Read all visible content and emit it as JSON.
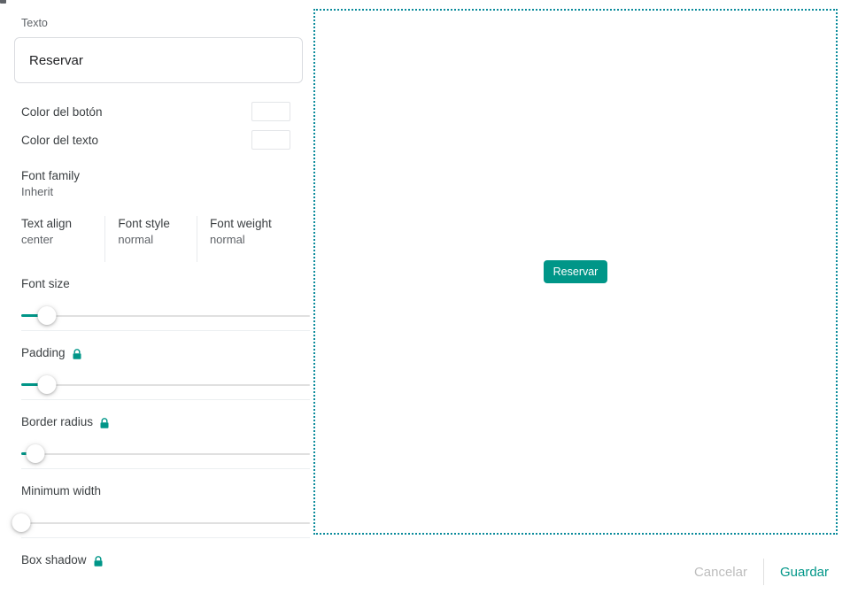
{
  "colors": {
    "accent": "#009688",
    "preview_border": "#0b8b9b",
    "button_color": "#009688",
    "text_color": "#ffffff",
    "muted": "#5f6368",
    "cancel": "#bdbdbd"
  },
  "settings": {
    "text_field": {
      "label": "Texto",
      "value": "Reservar",
      "placeholder": "Texto"
    },
    "button_color": {
      "label": "Color del botón",
      "swatch": "#009688"
    },
    "text_color": {
      "label": "Color del texto",
      "swatch": "#ffffff"
    },
    "font_family": {
      "label": "Font family",
      "value": "Inherit"
    },
    "typography": [
      {
        "label": "Text align",
        "value": "center"
      },
      {
        "label": "Font style",
        "value": "normal"
      },
      {
        "label": "Font weight",
        "value": "normal"
      }
    ],
    "sliders": [
      {
        "label": "Font size",
        "locked": false,
        "percent": 9
      },
      {
        "label": "Padding",
        "locked": true,
        "percent": 9
      },
      {
        "label": "Border radius",
        "locked": true,
        "percent": 5
      },
      {
        "label": "Minimum width",
        "locked": false,
        "percent": 0
      }
    ],
    "box_shadow": {
      "label": "Box shadow",
      "locked": true
    }
  },
  "preview": {
    "button_label": "Reservar"
  },
  "footer": {
    "cancel_label": "Cancelar",
    "save_label": "Guardar"
  },
  "icons": {
    "lock": "lock-icon"
  }
}
